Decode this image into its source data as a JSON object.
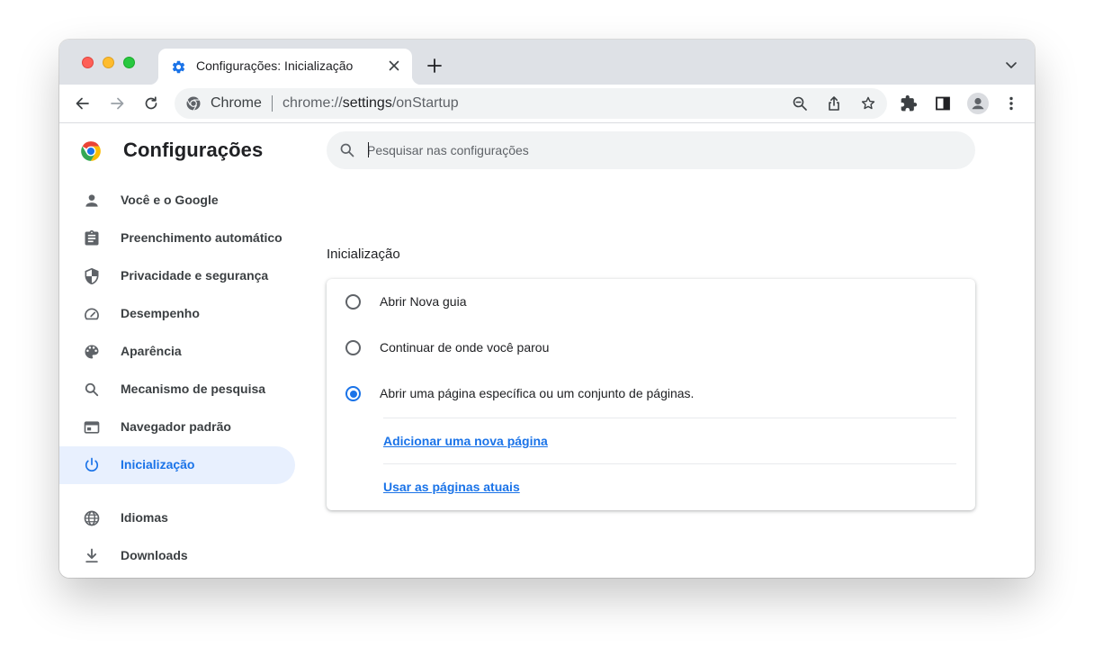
{
  "window": {
    "traffic_lights": [
      "close",
      "minimize",
      "zoom"
    ]
  },
  "tab": {
    "title": "Configurações: Inicialização",
    "icon": "gear-icon"
  },
  "toolbar": {
    "omnibox": {
      "site_label": "Chrome",
      "url_scheme": "chrome://",
      "url_host": "settings",
      "url_path": "/onStartup"
    },
    "icons": [
      "back-icon",
      "forward-icon",
      "reload-icon",
      "zoom-icon",
      "share-icon",
      "bookmark-star-icon",
      "extensions-icon",
      "side-panel-icon",
      "profile-icon",
      "menu-icon"
    ]
  },
  "settings": {
    "title": "Configurações",
    "search": {
      "placeholder": "Pesquisar nas configurações",
      "value": ""
    },
    "nav": [
      {
        "label": "Você e o Google",
        "icon": "person-icon"
      },
      {
        "label": "Preenchimento automático",
        "icon": "clipboard-icon"
      },
      {
        "label": "Privacidade e segurança",
        "icon": "shield-icon"
      },
      {
        "label": "Desempenho",
        "icon": "speedometer-icon"
      },
      {
        "label": "Aparência",
        "icon": "palette-icon"
      },
      {
        "label": "Mecanismo de pesquisa",
        "icon": "search-icon"
      },
      {
        "label": "Navegador padrão",
        "icon": "browser-window-icon"
      },
      {
        "label": "Inicialização",
        "icon": "power-icon",
        "active": true
      },
      {
        "label": "Idiomas",
        "icon": "globe-icon"
      },
      {
        "label": "Downloads",
        "icon": "download-icon"
      }
    ],
    "section_title": "Inicialização",
    "options": [
      {
        "label": "Abrir Nova guia",
        "checked": false
      },
      {
        "label": "Continuar de onde você parou",
        "checked": false
      },
      {
        "label": "Abrir uma página específica ou um conjunto de páginas.",
        "checked": true
      }
    ],
    "links": {
      "add_page": "Adicionar uma nova página",
      "use_current": "Usar as páginas atuais"
    }
  },
  "colors": {
    "accent": "#1a73e8",
    "active_nav_bg": "#e8f0fe",
    "tabstrip_bg": "#dee1e6",
    "omnibox_bg": "#f1f3f4"
  }
}
